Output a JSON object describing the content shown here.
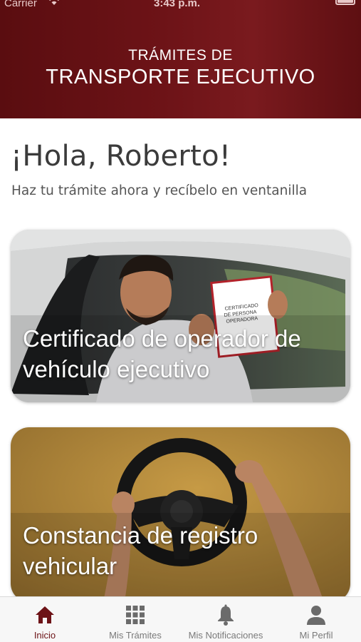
{
  "status_bar": {
    "carrier": "Carrier",
    "time": "3:43 p.m.",
    "icons": [
      "wifi-icon",
      "battery-icon"
    ]
  },
  "header": {
    "line1": "TRÁMITES DE",
    "line2": "TRANSPORTE EJECUTIVO",
    "background_color": "#6d1317"
  },
  "greeting": {
    "title": "¡Hola, Roberto!",
    "subtitle": "Haz tu trámite ahora y recíbelo en ventanilla"
  },
  "cards": [
    {
      "title_line1": "Certificado de operador de",
      "title_line2": "vehículo ejecutivo",
      "image": "driver-with-certificate-photo"
    },
    {
      "title_line1": "Constancia de registro",
      "title_line2": "vehicular",
      "image": "steering-wheel-photo"
    }
  ],
  "tabbar": {
    "active_color": "#6d1317",
    "inactive_color": "#7a7a7a",
    "tabs": [
      {
        "label": "Inicio",
        "icon": "home-icon",
        "active": true
      },
      {
        "label": "Mis Trámites",
        "icon": "grid-icon",
        "active": false
      },
      {
        "label": "Mis Notificaciones",
        "icon": "bell-icon",
        "active": false
      },
      {
        "label": "Mi Perfil",
        "icon": "person-icon",
        "active": false
      }
    ]
  }
}
